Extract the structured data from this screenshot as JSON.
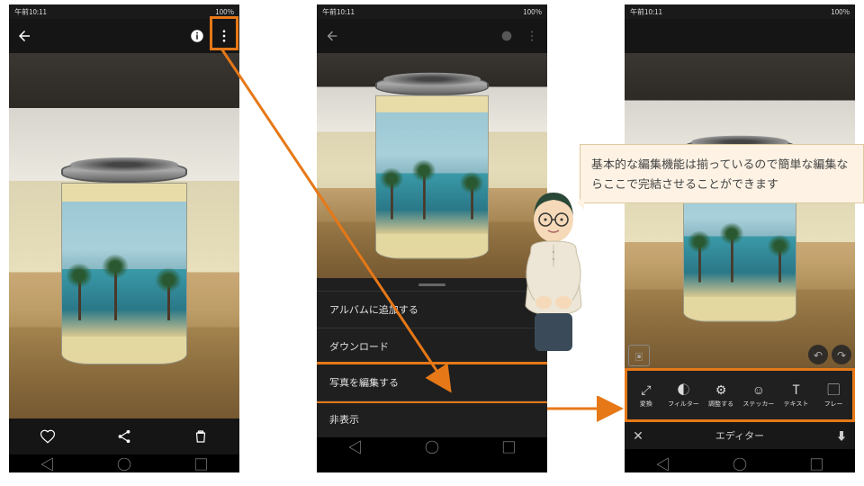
{
  "status": {
    "time": "午前10:11",
    "battery": "100%"
  },
  "phone1": {
    "actions": {
      "fav": "♡",
      "share": "<",
      "trash": "🗑"
    }
  },
  "menu": {
    "items": [
      "アルバムに追加する",
      "ダウンロード",
      "写真を編集する",
      "非表示"
    ],
    "highlightIndex": 2
  },
  "editor": {
    "tools": [
      {
        "icon": "⤢",
        "label": "変換"
      },
      {
        "icon": "◐",
        "label": "フィルター"
      },
      {
        "icon": "⚙",
        "label": "調整する"
      },
      {
        "icon": "☺",
        "label": "ステッカー"
      },
      {
        "icon": "T",
        "label": "テキスト"
      },
      {
        "icon": "▢",
        "label": "フレー"
      }
    ],
    "title": "エディター",
    "close": "✕",
    "download": "⬇"
  },
  "speech": "基本的な編集機能は揃っているので簡単な編集ならここで完結させることができます"
}
